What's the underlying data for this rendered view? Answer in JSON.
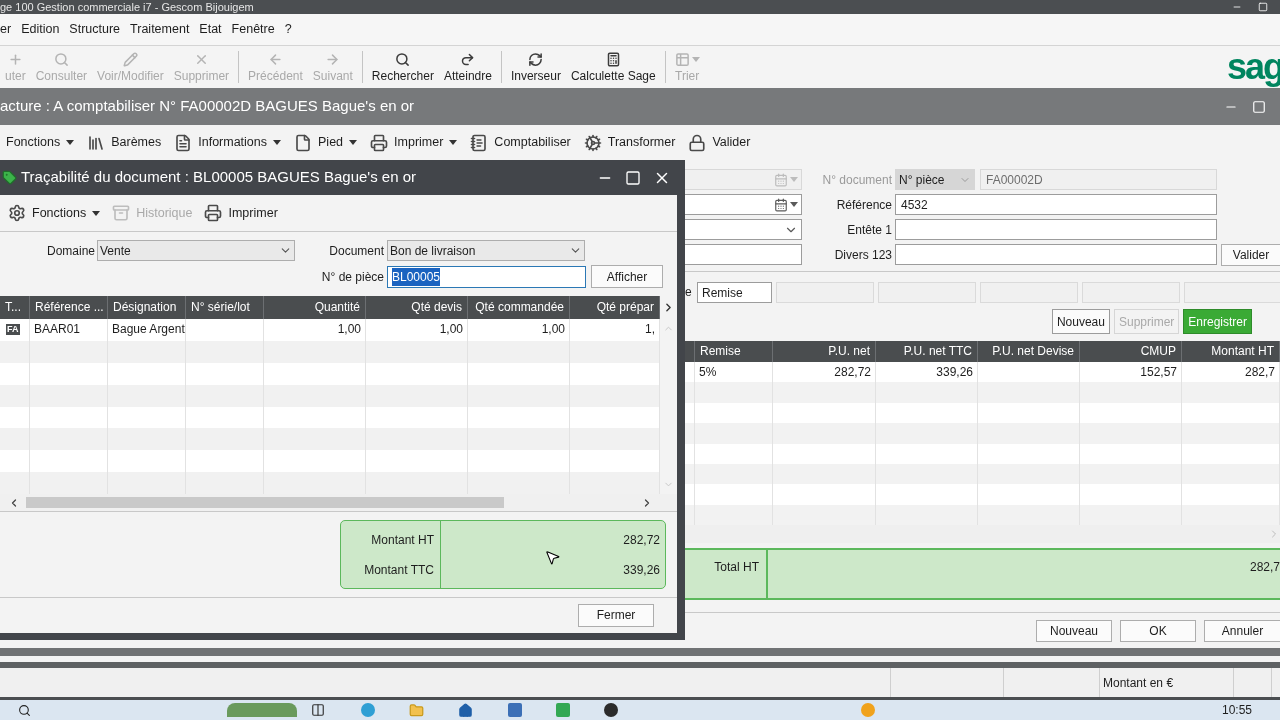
{
  "app_title": "ge 100 Gestion commerciale i7 - Gescom Bijouigem",
  "menu": [
    "er",
    "Edition",
    "Structure",
    "Traitement",
    "Etat",
    "Fenêtre",
    "?"
  ],
  "toolbar": [
    {
      "items": [
        {
          "label": "uter",
          "disabled": true,
          "has_menu": false
        },
        {
          "label": "Consulter",
          "disabled": true,
          "has_menu": false
        },
        {
          "label": "Voir/Modifier",
          "disabled": true,
          "has_menu": false
        },
        {
          "label": "Supprimer",
          "disabled": true,
          "has_menu": false
        }
      ]
    },
    {
      "items": [
        {
          "label": "Précédent",
          "disabled": true,
          "has_menu": false
        },
        {
          "label": "Suivant",
          "disabled": true,
          "has_menu": false
        }
      ]
    },
    {
      "items": [
        {
          "label": "Rechercher",
          "disabled": false,
          "has_menu": false
        },
        {
          "label": "Atteindre",
          "disabled": false,
          "has_menu": false
        }
      ]
    },
    {
      "items": [
        {
          "label": "Inverseur",
          "disabled": false,
          "has_menu": false
        },
        {
          "label": "Calculette Sage",
          "disabled": false,
          "has_menu": false
        }
      ]
    },
    {
      "items": [
        {
          "label": "Trier",
          "disabled": true,
          "has_menu": true
        }
      ]
    }
  ],
  "logo_text": "sag",
  "document_window": {
    "title": "acture : A comptabiliser N° FA00002D BAGUES Bague's en or",
    "toolbar": [
      {
        "label": "Fonctions",
        "has_menu": true
      },
      {
        "label": "Barèmes",
        "has_menu": false
      },
      {
        "label": "Informations",
        "has_menu": true
      },
      {
        "label": "Pied",
        "has_menu": true
      },
      {
        "label": "Imprimer",
        "has_menu": true
      },
      {
        "label": "Comptabiliser",
        "has_menu": false
      },
      {
        "label": "Transformer",
        "has_menu": false
      },
      {
        "label": "Valider",
        "has_menu": false
      }
    ],
    "side_fields": [
      {
        "kind": "date",
        "disabled": true
      },
      {
        "kind": "date",
        "disabled": false
      },
      {
        "kind": "select",
        "disabled": false
      },
      {
        "kind": "text",
        "disabled": false
      }
    ],
    "fields": [
      {
        "label": "N° document",
        "disabled": true,
        "selector": "N° pièce",
        "value": "FA00002D"
      },
      {
        "label": "Référence",
        "disabled": false,
        "value": "4532"
      },
      {
        "label": "Entête 1",
        "disabled": false
      },
      {
        "label": "Divers 123",
        "disabled": false
      }
    ],
    "validate_button": "Valider",
    "line_entry": {
      "cut_label": "e",
      "fields": [
        {
          "value": "Remise",
          "disabled": false
        },
        {
          "disabled": true
        },
        {
          "disabled": true
        },
        {
          "disabled": true
        },
        {
          "disabled": true
        },
        {
          "disabled": true
        }
      ]
    },
    "line_buttons": [
      {
        "label": "Nouveau",
        "kind": "default",
        "disabled": false
      },
      {
        "label": "Supprimer",
        "kind": "default",
        "disabled": true
      },
      {
        "label": "Enregistrer",
        "kind": "primary",
        "disabled": false
      }
    ],
    "lines_table": {
      "columns": [
        "Remise",
        "P.U. net",
        "P.U. net TTC",
        "P.U. net Devise",
        "CMUP",
        "Montant HT"
      ],
      "rows": [
        [
          "5%",
          "282,72",
          "339,26",
          null,
          "152,57",
          "282,7"
        ]
      ]
    },
    "total": {
      "label": "Total HT",
      "value": "282,7"
    },
    "buttons": [
      "Nouveau",
      "OK",
      "Annuler"
    ]
  },
  "traceability_dialog": {
    "title": "Traçabilité du document : BL00005 BAGUES Bague's en or",
    "toolbar": [
      {
        "label": "Fonctions",
        "disabled": false,
        "has_menu": true
      },
      {
        "label": "Historique",
        "disabled": true,
        "has_menu": false
      },
      {
        "label": "Imprimer",
        "disabled": false,
        "has_menu": false
      }
    ],
    "domain": {
      "label": "Domaine",
      "value": "Vente"
    },
    "document": {
      "label": "Document",
      "value": "Bon de livraison"
    },
    "piece": {
      "label": "N° de pièce",
      "value": "BL00005",
      "text_selected": true
    },
    "show_button": "Afficher",
    "table": {
      "columns": [
        "T...",
        "Référence ...",
        "Désignation",
        "N° série/lot",
        "Quantité",
        "Qté devis",
        "Qté commandée",
        "Qté prépar"
      ],
      "rows": [
        [
          "FA",
          "BAAR01",
          "Bague Argent",
          null,
          "1,00",
          "1,00",
          "1,00",
          "1,"
        ]
      ]
    },
    "totals": [
      {
        "label": "Montant HT",
        "value": "282,72"
      },
      {
        "label": "Montant TTC",
        "value": "339,26"
      }
    ],
    "close_button": "Fermer"
  },
  "status_bar": {
    "currency": "Montant en €"
  },
  "taskbar": {
    "time": "10:55"
  }
}
